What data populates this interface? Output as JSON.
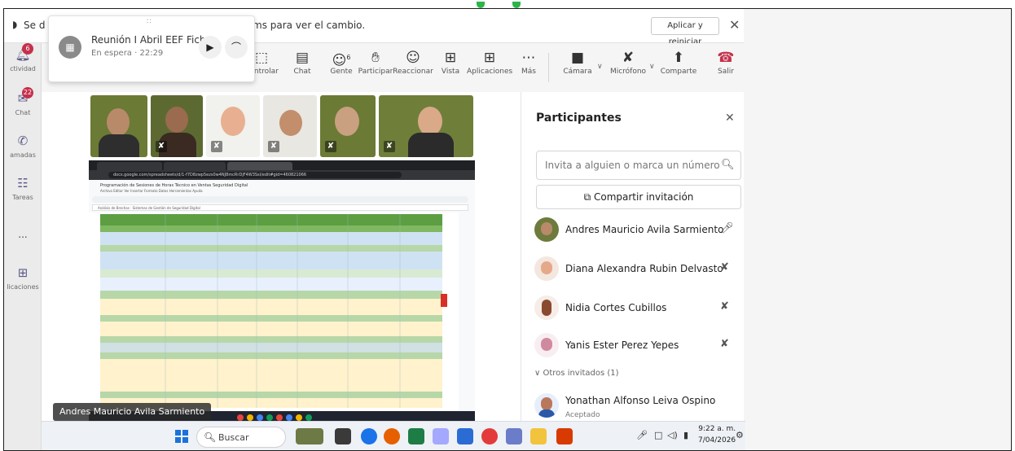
{
  "notice": {
    "text_start": "Se d",
    "text_end": "ms para ver el cambio.",
    "apply_label": "Aplicar y reiniciar",
    "close_glyph": "✕"
  },
  "rail": {
    "items": [
      {
        "label": "ctividad",
        "badge": "6",
        "icon": "bell-icon"
      },
      {
        "label": "Chat",
        "badge": "22",
        "icon": "chat-icon"
      },
      {
        "label": "amadas",
        "badge": "",
        "icon": "phone-icon"
      },
      {
        "label": "Tareas",
        "badge": "",
        "icon": "clipboard-icon"
      },
      {
        "label": "...",
        "badge": "",
        "icon": "more-icon"
      },
      {
        "label": "licaciones",
        "badge": "",
        "icon": "add-app-icon"
      }
    ]
  },
  "mini_window": {
    "title": "Reunión I Abril EEF Fich",
    "status": "En espera · 22:29"
  },
  "toolbar": {
    "controlar": "Controlar",
    "chat": "Chat",
    "gente": "Gente",
    "gente_count": "6",
    "participar": "Participar",
    "reaccionar": "Reaccionar",
    "vista": "Vista",
    "aplicaciones": "Aplicaciones",
    "mas": "Más",
    "camara": "Cámara",
    "microfono": "Micrófono",
    "compartir": "Comparte",
    "salir": "Salir"
  },
  "stage": {
    "presenter_tag": "Andres Mauricio Avila Sarmiento",
    "shared_doc_title": "Programación de Sesiones de Horas Técnico en Ventas Seguridad Digital",
    "shared_menu": "Archivo  Editar  Ver  Insertar  Formato  Datos  Herramientas  Ayuda",
    "shared_formula": "Análisis de Brechas · Sistemas de Gestión de Seguridad Digital",
    "shared_url": "docs.google.com/spreadsheets/d/1-f7D8zwp5ezs0w4NJ8mcRrDjF4W3Ssl/edit#gid=460821066"
  },
  "panel": {
    "title": "Participantes",
    "search_placeholder": "Invita a alguien o marca un número",
    "share_label": "Compartir invitación",
    "people": [
      {
        "name": "Andres Mauricio Avila Sarmiento",
        "mic": "on"
      },
      {
        "name": "Diana Alexandra Rubin Delvasto",
        "mic": "off"
      },
      {
        "name": "Nidia Cortes Cubillos",
        "mic": "off"
      },
      {
        "name": "Yanis Ester Perez Yepes",
        "mic": "off"
      }
    ],
    "others_label": "Otros invitados (1)",
    "guest": {
      "name": "Yonathan Alfonso Leiva Ospino",
      "status": "Aceptado"
    }
  },
  "taskbar": {
    "search_label": "Buscar",
    "time": "9:22 a. m.",
    "date": "7/04/2026"
  },
  "colors": {
    "accent_green": "#2db54a",
    "leave_red": "#c4314b",
    "badge_red": "#c4314b",
    "teams_purple": "#5b5b8a"
  }
}
